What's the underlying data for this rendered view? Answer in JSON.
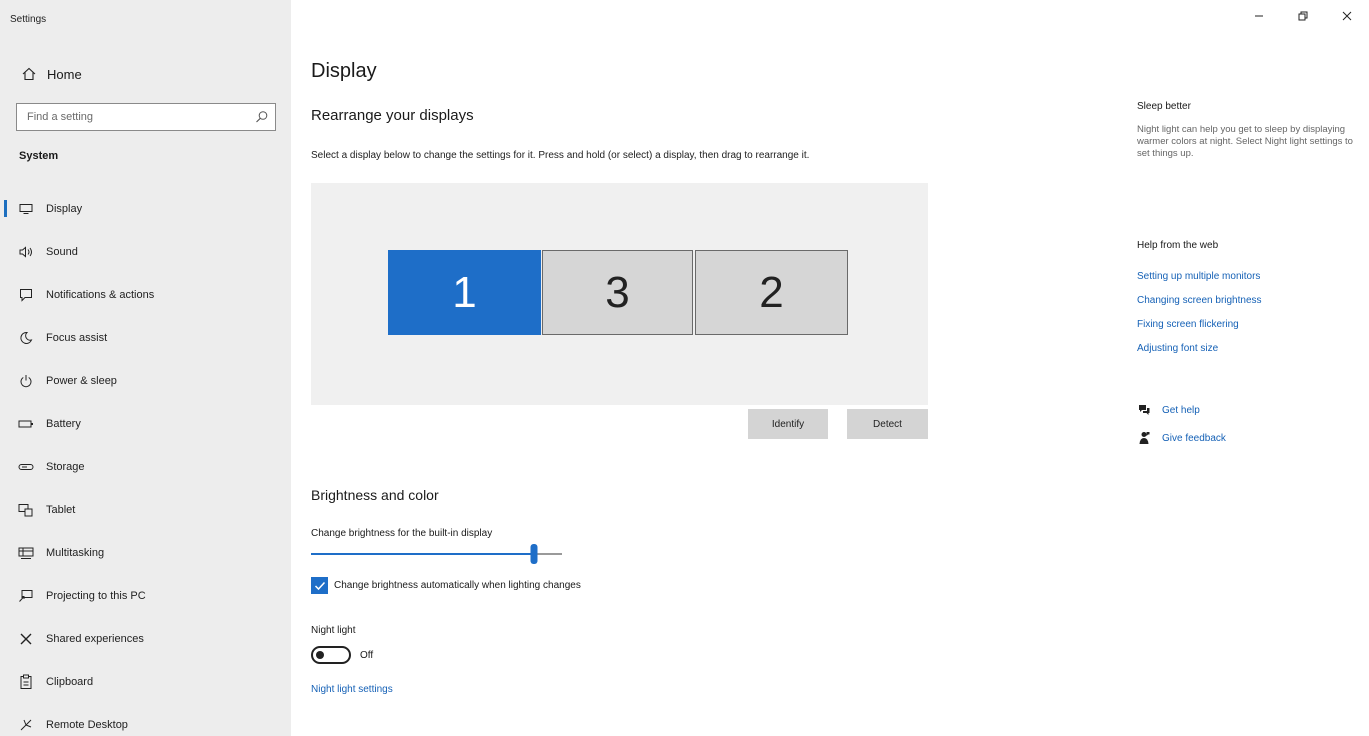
{
  "window": {
    "title": "Settings",
    "controls": [
      "minimize",
      "restore",
      "close"
    ]
  },
  "sidebar": {
    "home_label": "Home",
    "search_placeholder": "Find a setting",
    "section_label": "System",
    "items": [
      {
        "label": "Display",
        "icon": "monitor-icon",
        "active": true
      },
      {
        "label": "Sound",
        "icon": "speaker-icon"
      },
      {
        "label": "Notifications & actions",
        "icon": "notification-icon"
      },
      {
        "label": "Focus assist",
        "icon": "moon-icon"
      },
      {
        "label": "Power & sleep",
        "icon": "power-icon"
      },
      {
        "label": "Battery",
        "icon": "battery-icon"
      },
      {
        "label": "Storage",
        "icon": "storage-icon"
      },
      {
        "label": "Tablet",
        "icon": "tablet-icon"
      },
      {
        "label": "Multitasking",
        "icon": "multitasking-icon"
      },
      {
        "label": "Projecting to this PC",
        "icon": "projecting-icon"
      },
      {
        "label": "Shared experiences",
        "icon": "shared-icon"
      },
      {
        "label": "Clipboard",
        "icon": "clipboard-icon"
      },
      {
        "label": "Remote Desktop",
        "icon": "remote-desktop-icon"
      }
    ]
  },
  "main": {
    "title": "Display",
    "rearrange": {
      "heading": "Rearrange your displays",
      "description": "Select a display below to change the settings for it. Press and hold (or select) a display, then drag to rearrange it.",
      "monitors": [
        "1",
        "3",
        "2"
      ],
      "selected_monitor": "1",
      "identify_label": "Identify",
      "detect_label": "Detect"
    },
    "brightness": {
      "heading": "Brightness and color",
      "slider_label": "Change brightness for the built-in display",
      "level": 0.89,
      "auto_label": "Change brightness automatically when lighting changes",
      "auto_checked": true,
      "night_light_label": "Night light",
      "night_light_state": "Off",
      "night_light_settings_link": "Night light settings"
    }
  },
  "right_panel": {
    "sleep": {
      "heading": "Sleep better",
      "text": "Night light can help you get to sleep by displaying warmer colors at night. Select Night light settings to set things up."
    },
    "help": {
      "heading": "Help from the web",
      "links": [
        "Setting up multiple monitors",
        "Changing screen brightness",
        "Fixing screen flickering",
        "Adjusting font size"
      ]
    },
    "get_help_label": "Get help",
    "give_feedback_label": "Give feedback"
  },
  "colors": {
    "accent": "#1e6ec8",
    "sidebar_bg": "#ededed",
    "link": "#1561b6"
  }
}
